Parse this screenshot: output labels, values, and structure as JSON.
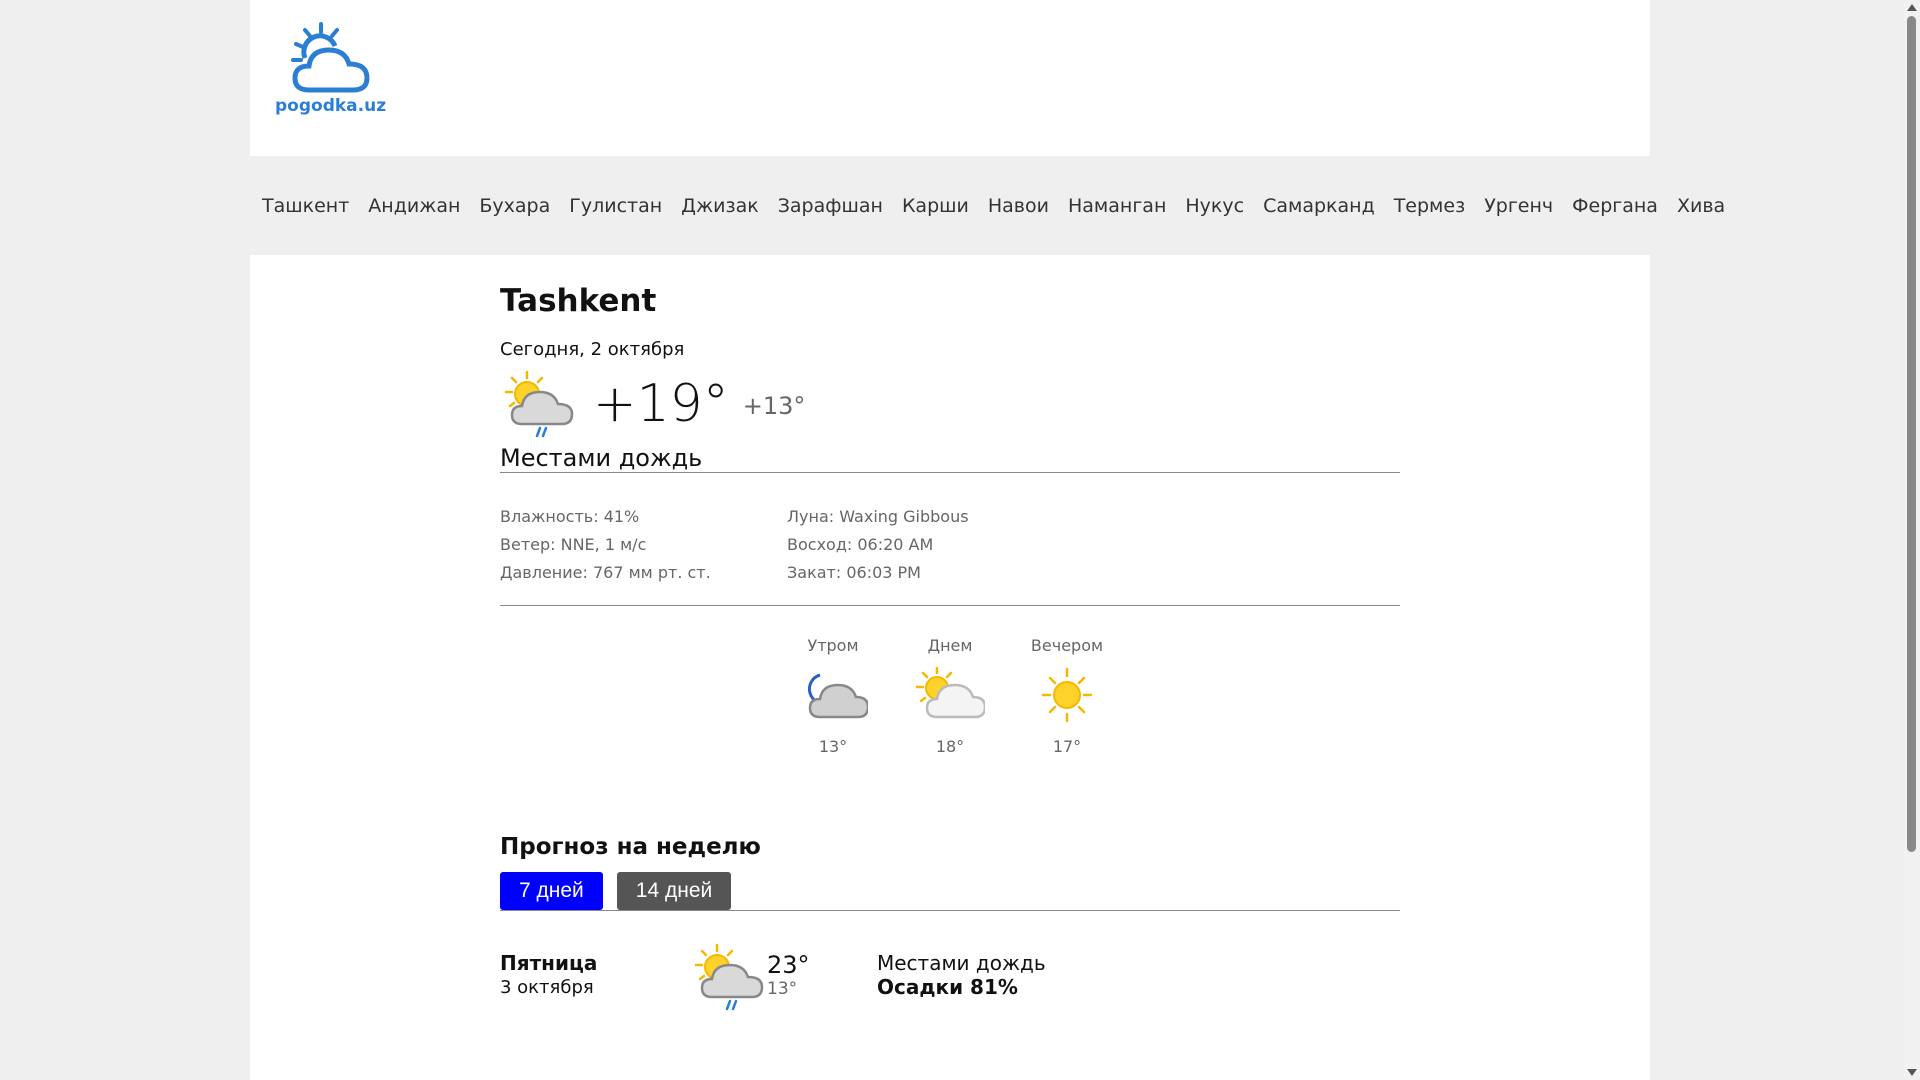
{
  "site": {
    "logo_text": "pogodka.uz"
  },
  "nav": {
    "cities": [
      "Ташкент",
      "Андижан",
      "Бухара",
      "Гулистан",
      "Джизак",
      "Зарафшан",
      "Карши",
      "Навои",
      "Наманган",
      "Нукус",
      "Самарканд",
      "Термез",
      "Ургенч",
      "Фергана",
      "Хива"
    ]
  },
  "current": {
    "city": "Tashkent",
    "date": "Сегодня, 2 октября",
    "temp": "+19°",
    "temp_night": "+13°",
    "condition": "Местами дождь",
    "icon": "partly-cloudy-rain-icon"
  },
  "details": {
    "humidity": "Влажность: 41%",
    "wind": "Ветер: NNE, 1 м/с",
    "pressure": "Давление: 767 мм рт. ст.",
    "moon": "Луна: Waxing Gibbous",
    "sunrise": "Восход: 06:20 AM",
    "sunset": "Закат: 06:03 PM"
  },
  "dayparts": [
    {
      "label": "Утром",
      "temp": "13°",
      "icon": "moon-cloud-icon"
    },
    {
      "label": "Днем",
      "temp": "18°",
      "icon": "sun-cloud-icon"
    },
    {
      "label": "Вечером",
      "temp": "17°",
      "icon": "sun-icon"
    }
  ],
  "week": {
    "title": "Прогноз на неделю",
    "btn_7": "7 дней",
    "btn_14": "14 дней",
    "active": "7"
  },
  "forecast": [
    {
      "day": "Пятница",
      "date": "3 октября",
      "hi": "23°",
      "lo": "13°",
      "condition": "Местами дождь",
      "precip": "Осадки 81%",
      "icon": "partly-cloudy-rain-icon"
    }
  ],
  "colors": {
    "brand": "#2a7fd4",
    "active_button": "#0000ff",
    "inactive_button": "#555555",
    "sun": "#f5b800",
    "cloud": "#b8b8b8"
  }
}
